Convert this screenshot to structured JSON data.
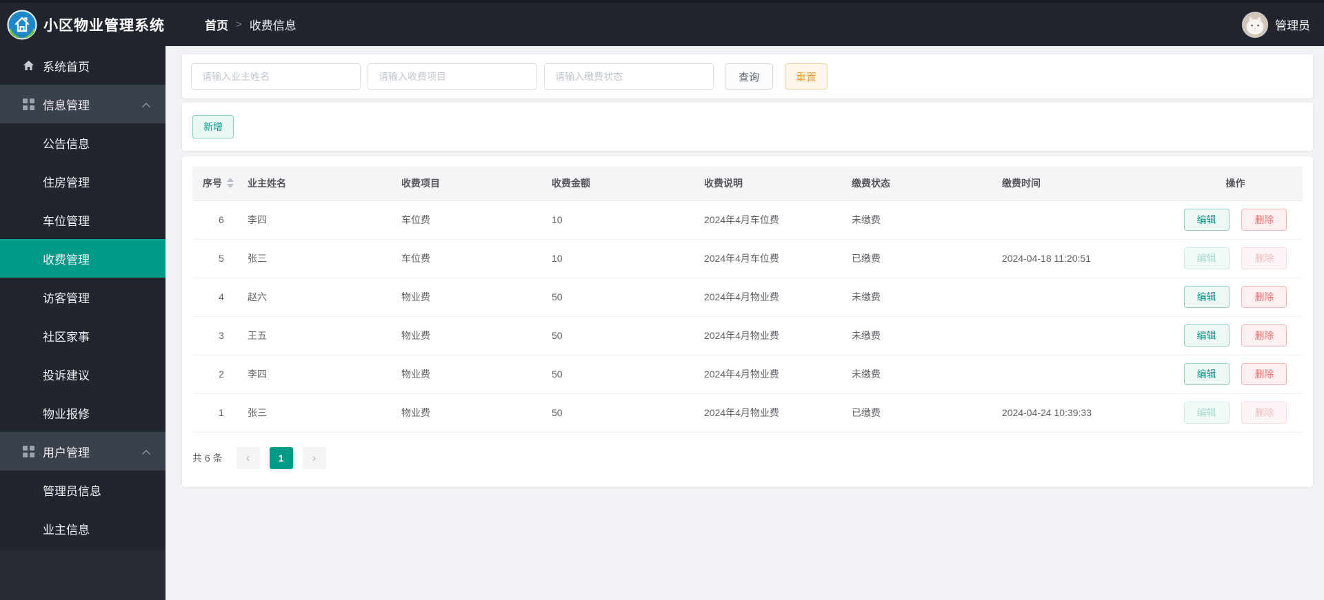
{
  "colors": {
    "accent": "#009a89",
    "warning": "#e6a23c",
    "danger": "#f56c6c",
    "header_bg": "#21252d"
  },
  "topbar": {
    "app_title": "小区物业管理系统",
    "breadcrumb": {
      "home": "首页",
      "separator": ">",
      "current": "收费信息"
    },
    "user_name": "管理员"
  },
  "sidebar": {
    "items": [
      {
        "label": "系统首页",
        "type": "root",
        "iconHome": true
      },
      {
        "label": "信息管理",
        "type": "parent",
        "iconGrid": true,
        "expanded": true
      },
      {
        "label": "公告信息",
        "type": "child"
      },
      {
        "label": "住房管理",
        "type": "child"
      },
      {
        "label": "车位管理",
        "type": "child"
      },
      {
        "label": "收费管理",
        "type": "child",
        "active": true
      },
      {
        "label": "访客管理",
        "type": "child"
      },
      {
        "label": "社区家事",
        "type": "child"
      },
      {
        "label": "投诉建议",
        "type": "child"
      },
      {
        "label": "物业报修",
        "type": "child"
      },
      {
        "label": "用户管理",
        "type": "parent",
        "iconGrid": true,
        "expanded": true
      },
      {
        "label": "管理员信息",
        "type": "child"
      },
      {
        "label": "业主信息",
        "type": "child"
      }
    ]
  },
  "search": {
    "inputs": [
      {
        "placeholder": "请输入业主姓名"
      },
      {
        "placeholder": "请输入收费项目"
      },
      {
        "placeholder": "请输入缴费状态"
      }
    ],
    "query_label": "查询",
    "reset_label": "重置"
  },
  "toolbar": {
    "add_label": "新增"
  },
  "table": {
    "columns": [
      "序号",
      "业主姓名",
      "收费项目",
      "收费金额",
      "收费说明",
      "缴费状态",
      "缴费时间",
      "操作"
    ],
    "edit_label": "编辑",
    "delete_label": "删除",
    "rows": [
      {
        "seq": "6",
        "owner": "李四",
        "item": "车位费",
        "amount": "10",
        "desc": "2024年4月车位费",
        "status": "未缴费",
        "time": ""
      },
      {
        "seq": "5",
        "owner": "张三",
        "item": "车位费",
        "amount": "10",
        "desc": "2024年4月车位费",
        "status": "已缴费",
        "time": "2024-04-18 11:20:51",
        "disabled": true
      },
      {
        "seq": "4",
        "owner": "赵六",
        "item": "物业费",
        "amount": "50",
        "desc": "2024年4月物业费",
        "status": "未缴费",
        "time": ""
      },
      {
        "seq": "3",
        "owner": "王五",
        "item": "物业费",
        "amount": "50",
        "desc": "2024年4月物业费",
        "status": "未缴费",
        "time": ""
      },
      {
        "seq": "2",
        "owner": "李四",
        "item": "物业费",
        "amount": "50",
        "desc": "2024年4月物业费",
        "status": "未缴费",
        "time": ""
      },
      {
        "seq": "1",
        "owner": "张三",
        "item": "物业费",
        "amount": "50",
        "desc": "2024年4月物业费",
        "status": "已缴费",
        "time": "2024-04-24 10:39:33",
        "disabled": true
      }
    ]
  },
  "pagination": {
    "total_text": "共 6 条",
    "prev_glyph": "‹",
    "next_glyph": "›",
    "current_page": "1"
  }
}
